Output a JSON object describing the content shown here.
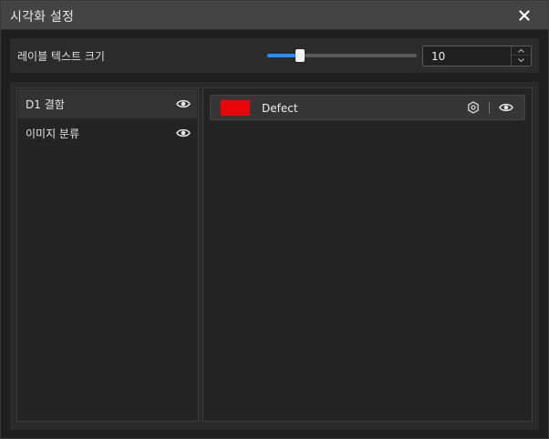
{
  "window": {
    "title": "시각화 설정",
    "close_icon": "close-icon"
  },
  "label_text_size": {
    "label": "레이블 텍스트 크기",
    "value": "10",
    "slider_fraction": 0.22,
    "accent_color": "#2d8cf0"
  },
  "tasks": {
    "items": [
      {
        "label": "D1 결함",
        "selected": true,
        "visibility_icon": "eye-icon"
      },
      {
        "label": "이미지 분류",
        "selected": false,
        "visibility_icon": "eye-icon"
      }
    ]
  },
  "classes": {
    "items": [
      {
        "name": "Defect",
        "color": "#e8060a",
        "settings_icon": "gear-icon",
        "visibility_icon": "eye-icon"
      }
    ]
  }
}
